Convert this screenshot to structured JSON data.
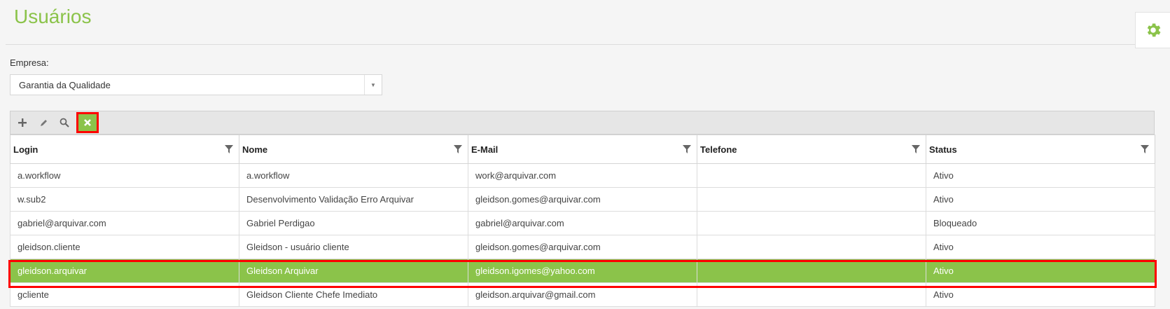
{
  "page": {
    "title": "Usuários",
    "accent_color": "#8bc34a",
    "settings_icon": "gear-icon"
  },
  "filter": {
    "empresa_label": "Empresa:",
    "empresa_value": "Garantia da Qualidade"
  },
  "toolbar": {
    "add_icon": "plus-icon",
    "edit_icon": "pencil-icon",
    "search_icon": "search-icon",
    "clear_icon": "close-icon"
  },
  "grid": {
    "columns": [
      "Login",
      "Nome",
      "E-Mail",
      "Telefone",
      "Status"
    ],
    "rows": [
      {
        "login": "a.workflow",
        "nome": "a.workflow",
        "email": "work@arquivar.com",
        "telefone": "",
        "status": "Ativo"
      },
      {
        "login": "w.sub2",
        "nome": "Desenvolvimento Validação Erro Arquivar",
        "email": "gleidson.gomes@arquivar.com",
        "telefone": "",
        "status": "Ativo"
      },
      {
        "login": "gabriel@arquivar.com",
        "nome": "Gabriel Perdigao",
        "email": "gabriel@arquivar.com",
        "telefone": "",
        "status": "Bloqueado"
      },
      {
        "login": "gleidson.cliente",
        "nome": "Gleidson - usuário cliente",
        "email": "gleidson.gomes@arquivar.com",
        "telefone": "",
        "status": "Ativo"
      },
      {
        "login": "gleidson.arquivar",
        "nome": "Gleidson Arquivar",
        "email": "gleidson.igomes@yahoo.com",
        "telefone": "",
        "status": "Ativo"
      },
      {
        "login": "gcliente",
        "nome": "Gleidson Cliente Chefe Imediato",
        "email": "gleidson.arquivar@gmail.com",
        "telefone": "",
        "status": "Ativo"
      }
    ],
    "selected_row": 4
  }
}
